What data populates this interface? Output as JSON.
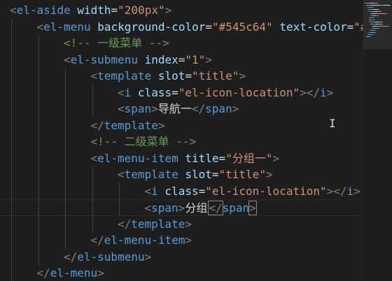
{
  "editor": {
    "language": "html",
    "lines": [
      {
        "indent": 0,
        "tokens": [
          {
            "t": "<",
            "c": "punc"
          },
          {
            "t": "el-aside",
            "c": "tag"
          },
          {
            "t": " ",
            "c": "text"
          },
          {
            "t": "width",
            "c": "attr"
          },
          {
            "t": "=",
            "c": "eq"
          },
          {
            "t": "\"200px\"",
            "c": "str"
          },
          {
            "t": ">",
            "c": "punc"
          }
        ]
      },
      {
        "indent": 1,
        "tokens": [
          {
            "t": "<",
            "c": "punc"
          },
          {
            "t": "el-menu",
            "c": "tag"
          },
          {
            "t": " ",
            "c": "text"
          },
          {
            "t": "background-color",
            "c": "attr"
          },
          {
            "t": "=",
            "c": "eq"
          },
          {
            "t": "\"#545c64\"",
            "c": "str"
          },
          {
            "t": " ",
            "c": "text"
          },
          {
            "t": "text-color",
            "c": "attr"
          },
          {
            "t": "=",
            "c": "eq"
          },
          {
            "t": "\"#",
            "c": "str"
          }
        ]
      },
      {
        "indent": 2,
        "tokens": [
          {
            "t": "<!-- 一级菜单 -->",
            "c": "comment"
          }
        ]
      },
      {
        "indent": 2,
        "tokens": [
          {
            "t": "<",
            "c": "punc"
          },
          {
            "t": "el-submenu",
            "c": "tag"
          },
          {
            "t": " ",
            "c": "text"
          },
          {
            "t": "index",
            "c": "attr"
          },
          {
            "t": "=",
            "c": "eq"
          },
          {
            "t": "\"1\"",
            "c": "str"
          },
          {
            "t": ">",
            "c": "punc"
          }
        ]
      },
      {
        "indent": 3,
        "tokens": [
          {
            "t": "<",
            "c": "punc"
          },
          {
            "t": "template",
            "c": "tag"
          },
          {
            "t": " ",
            "c": "text"
          },
          {
            "t": "slot",
            "c": "attr"
          },
          {
            "t": "=",
            "c": "eq"
          },
          {
            "t": "\"title\"",
            "c": "str"
          },
          {
            "t": ">",
            "c": "punc"
          }
        ]
      },
      {
        "indent": 4,
        "tokens": [
          {
            "t": "<",
            "c": "punc"
          },
          {
            "t": "i",
            "c": "tag"
          },
          {
            "t": " ",
            "c": "text"
          },
          {
            "t": "class",
            "c": "attr"
          },
          {
            "t": "=",
            "c": "eq"
          },
          {
            "t": "\"el-icon-location\"",
            "c": "str"
          },
          {
            "t": "></",
            "c": "punc"
          },
          {
            "t": "i",
            "c": "tag"
          },
          {
            "t": ">",
            "c": "punc"
          }
        ]
      },
      {
        "indent": 4,
        "tokens": [
          {
            "t": "<",
            "c": "punc"
          },
          {
            "t": "span",
            "c": "tag"
          },
          {
            "t": ">",
            "c": "punc"
          },
          {
            "t": "导航一",
            "c": "text"
          },
          {
            "t": "</",
            "c": "punc"
          },
          {
            "t": "span",
            "c": "tag"
          },
          {
            "t": ">",
            "c": "punc"
          }
        ]
      },
      {
        "indent": 3,
        "tokens": [
          {
            "t": "</",
            "c": "punc"
          },
          {
            "t": "template",
            "c": "tag"
          },
          {
            "t": ">",
            "c": "punc"
          }
        ]
      },
      {
        "indent": 3,
        "tokens": [
          {
            "t": "<!-- 二级菜单 -->",
            "c": "comment"
          }
        ]
      },
      {
        "indent": 3,
        "tokens": [
          {
            "t": "<",
            "c": "punc"
          },
          {
            "t": "el-menu-item",
            "c": "tag"
          },
          {
            "t": " ",
            "c": "text"
          },
          {
            "t": "title",
            "c": "attr"
          },
          {
            "t": "=",
            "c": "eq"
          },
          {
            "t": "\"分组一\"",
            "c": "str"
          },
          {
            "t": ">",
            "c": "punc"
          }
        ]
      },
      {
        "indent": 4,
        "tokens": [
          {
            "t": "<",
            "c": "punc"
          },
          {
            "t": "template",
            "c": "tag"
          },
          {
            "t": " ",
            "c": "text"
          },
          {
            "t": "slot",
            "c": "attr"
          },
          {
            "t": "=",
            "c": "eq"
          },
          {
            "t": "\"title\"",
            "c": "str"
          },
          {
            "t": ">",
            "c": "punc"
          }
        ]
      },
      {
        "indent": 5,
        "tokens": [
          {
            "t": "<",
            "c": "punc"
          },
          {
            "t": "i",
            "c": "tag"
          },
          {
            "t": " ",
            "c": "text"
          },
          {
            "t": "class",
            "c": "attr"
          },
          {
            "t": "=",
            "c": "eq"
          },
          {
            "t": "\"el-icon-location\"",
            "c": "str"
          },
          {
            "t": "></",
            "c": "punc"
          },
          {
            "t": "i",
            "c": "tag"
          },
          {
            "t": ">",
            "c": "punc"
          }
        ]
      },
      {
        "indent": 5,
        "current": true,
        "tokens": [
          {
            "t": "<",
            "c": "punc"
          },
          {
            "t": "span",
            "c": "tag"
          },
          {
            "t": ">",
            "c": "punc"
          },
          {
            "t": "分组",
            "c": "text"
          },
          {
            "t": "|",
            "c": "cursor"
          },
          {
            "t": "</",
            "c": "punc",
            "match": true
          },
          {
            "t": "span",
            "c": "tag"
          },
          {
            "t": ">",
            "c": "punc",
            "match": true
          }
        ]
      },
      {
        "indent": 4,
        "tokens": [
          {
            "t": "</",
            "c": "punc"
          },
          {
            "t": "template",
            "c": "tag"
          },
          {
            "t": ">",
            "c": "punc"
          }
        ]
      },
      {
        "indent": 3,
        "tokens": [
          {
            "t": "</",
            "c": "punc"
          },
          {
            "t": "el-menu-item",
            "c": "tag"
          },
          {
            "t": ">",
            "c": "punc"
          }
        ]
      },
      {
        "indent": 2,
        "tokens": [
          {
            "t": "</",
            "c": "punc"
          },
          {
            "t": "el-submenu",
            "c": "tag"
          },
          {
            "t": ">",
            "c": "punc"
          }
        ]
      },
      {
        "indent": 1,
        "tokens": [
          {
            "t": "</",
            "c": "punc"
          },
          {
            "t": "el-menu",
            "c": "tag"
          },
          {
            "t": ">",
            "c": "punc"
          }
        ]
      }
    ]
  },
  "colors": {
    "background": "#1e1e1e",
    "tag": "#569cd6",
    "attribute": "#9cdcfe",
    "string": "#ce9178",
    "comment": "#6a9955",
    "punctuation": "#808080",
    "text": "#d4d4d4"
  },
  "icons": {
    "mouse_pointer": "text-cursor-icon",
    "minimap": "minimap"
  }
}
